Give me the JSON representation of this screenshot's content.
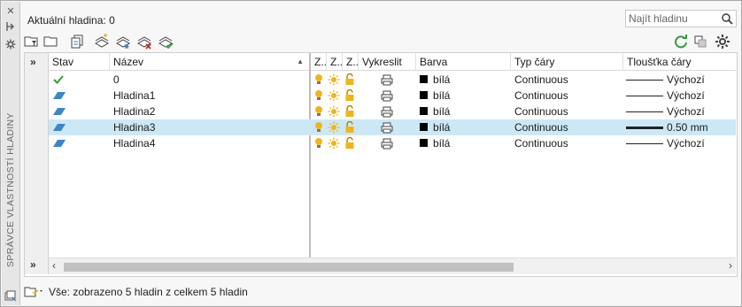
{
  "palette_title": "SPRÁVCE VLASTNOSTÍ HLADINY",
  "current_layer_label": "Aktuální hladina: 0",
  "search": {
    "placeholder": "Najít hladinu"
  },
  "columns": {
    "stav": "Stav",
    "nazev": "Název",
    "zap": "Z...",
    "zmraz": "Z...",
    "zamk": "Z...",
    "vykreslit": "Vykreslit",
    "barva": "Barva",
    "typ_cary": "Typ čáry",
    "tloustka": "Tloušťka čáry"
  },
  "layers": [
    {
      "name": "0",
      "status": "current",
      "color": "bílá",
      "linetype": "Continuous",
      "lineweight": "Výchozí",
      "lw_thick": false,
      "selected": false
    },
    {
      "name": "Hladina1",
      "status": "layer",
      "color": "bílá",
      "linetype": "Continuous",
      "lineweight": "Výchozí",
      "lw_thick": false,
      "selected": false
    },
    {
      "name": "Hladina2",
      "status": "layer",
      "color": "bílá",
      "linetype": "Continuous",
      "lineweight": "Výchozí",
      "lw_thick": false,
      "selected": false
    },
    {
      "name": "Hladina3",
      "status": "layer",
      "color": "bílá",
      "linetype": "Continuous",
      "lineweight": "0.50 mm",
      "lw_thick": true,
      "selected": true
    },
    {
      "name": "Hladina4",
      "status": "layer",
      "color": "bílá",
      "linetype": "Continuous",
      "lineweight": "Výchozí",
      "lw_thick": false,
      "selected": false
    }
  ],
  "status_text": "Vše: zobrazeno 5 hladin z celkem 5 hladin",
  "colors": {
    "selected_row": "#cce8f7",
    "bulb": "#f2b417",
    "check": "#2e9e3a",
    "refresh": "#2e9e3a",
    "layer_icon": "#3a86c8"
  },
  "icons": {
    "close": "close-icon",
    "autohide": "autohide-icon",
    "properties": "gear-icon",
    "new_layer": "new-layer-icon",
    "delete_layer": "delete-layer-icon",
    "set_current": "set-current-icon",
    "refresh": "refresh-icon",
    "settings": "gear-icon",
    "search": "search-icon",
    "expand": "chevron-double-right-icon",
    "filter": "filter-icon"
  }
}
